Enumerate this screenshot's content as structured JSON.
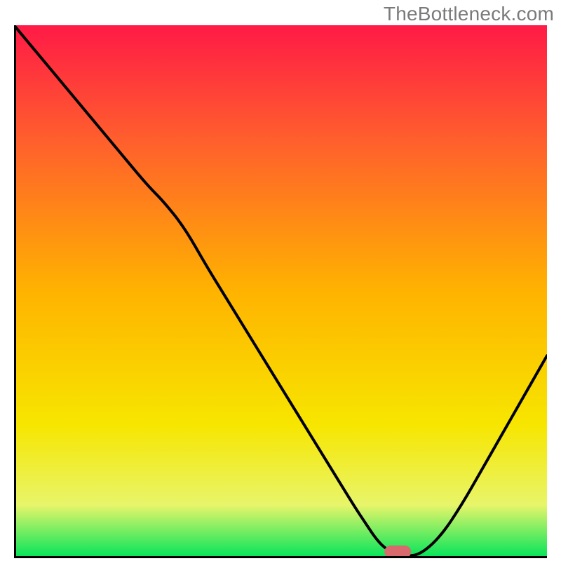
{
  "watermark": "TheBottleneck.com",
  "colors": {
    "watermark": "#7a7a7a",
    "curve": "#000000",
    "marker_fill": "#d86a6e",
    "frame": "#000000",
    "gradient": {
      "top": "#ff1a46",
      "g_20": "#ff5a2f",
      "g_50": "#ffb300",
      "g_75": "#f7e600",
      "g_90": "#e8f56a",
      "bottom": "#00e45a"
    }
  },
  "chart_data": {
    "type": "line",
    "title": "",
    "xlabel": "",
    "ylabel": "",
    "xlim": [
      0,
      100
    ],
    "ylim": [
      0,
      100
    ],
    "series": [
      {
        "name": "bottleneck-curve",
        "x": [
          0,
          5,
          10,
          15,
          20,
          25,
          28,
          32,
          36,
          40,
          44,
          48,
          52,
          56,
          60,
          64,
          66,
          68,
          70,
          73,
          76,
          80,
          84,
          88,
          92,
          96,
          100
        ],
        "y": [
          100,
          94,
          88,
          82,
          76,
          70,
          67,
          62,
          55,
          48.5,
          42,
          35.5,
          29,
          22.5,
          16,
          9.5,
          6.5,
          3.5,
          1.5,
          0.5,
          0.5,
          4,
          10,
          17,
          24,
          31,
          38
        ]
      }
    ],
    "marker": {
      "name": "optimal-region",
      "x_center": 72,
      "width_pct": 5,
      "y": 1.2
    }
  }
}
